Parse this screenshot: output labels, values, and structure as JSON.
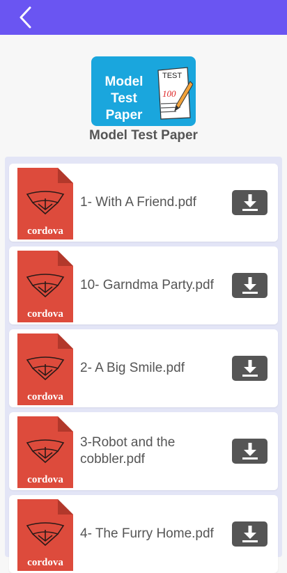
{
  "header": {
    "back_icon": "chevron-left-icon",
    "bar_color": "#6a55f2"
  },
  "logo": {
    "text_line1": "Model Test",
    "text_line2": "Paper",
    "paper_text": "TEST",
    "score_text": "100",
    "bg_color": "#1aa6dd"
  },
  "page_title": "Model Test Paper",
  "files": [
    {
      "name": "1- With A Friend.pdf",
      "icon_label": "cordova"
    },
    {
      "name": "10- Garndma Party.pdf",
      "icon_label": "cordova"
    },
    {
      "name": "2- A Big Smile.pdf",
      "icon_label": "cordova"
    },
    {
      "name": "3-Robot and the cobbler.pdf",
      "icon_label": "cordova"
    },
    {
      "name": "4- The Furry Home.pdf",
      "icon_label": "cordova"
    }
  ],
  "download_icon": "download-icon",
  "colors": {
    "file_icon_red": "#dd4b3c",
    "download_btn": "#555555"
  }
}
